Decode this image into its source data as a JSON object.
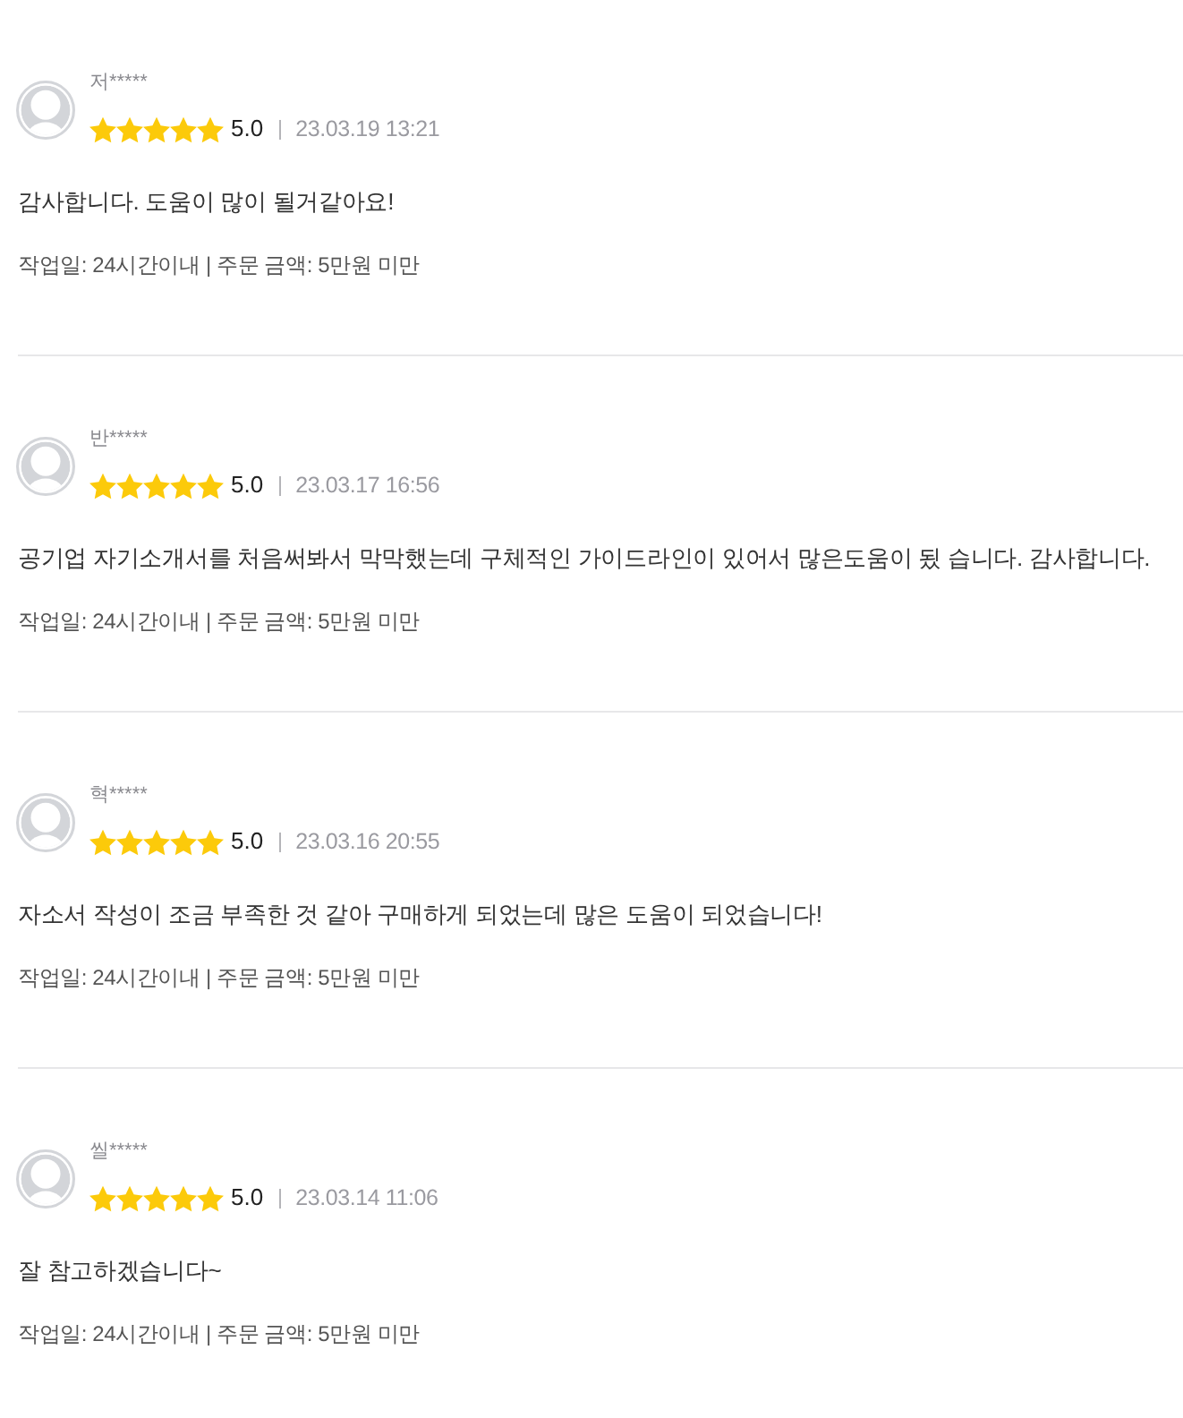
{
  "reviews": [
    {
      "user": "저*****",
      "stars": 5,
      "score": "5.0",
      "date": "23.03.19 13:21",
      "comment": "감사합니다. 도움이 많이 될거같아요!",
      "details": "작업일: 24시간이내 | 주문 금액: 5만원 미만"
    },
    {
      "user": "반*****",
      "stars": 5,
      "score": "5.0",
      "date": "23.03.17 16:56",
      "comment": "공기업 자기소개서를 처음써봐서 막막했는데 구체적인 가이드라인이 있어서 많은도움이 됬 습니다. 감사합니다.",
      "details": "작업일: 24시간이내 | 주문 금액: 5만원 미만"
    },
    {
      "user": "혁*****",
      "stars": 5,
      "score": "5.0",
      "date": "23.03.16 20:55",
      "comment": "자소서 작성이 조금 부족한 것 같아 구매하게 되었는데 많은 도움이 되었습니다!",
      "details": "작업일: 24시간이내 | 주문 금액: 5만원 미만"
    },
    {
      "user": "씰*****",
      "stars": 5,
      "score": "5.0",
      "date": "23.03.14 11:06",
      "comment": "잘 참고하겠습니다~",
      "details": "작업일: 24시간이내 | 주문 금액: 5만원 미만"
    }
  ]
}
